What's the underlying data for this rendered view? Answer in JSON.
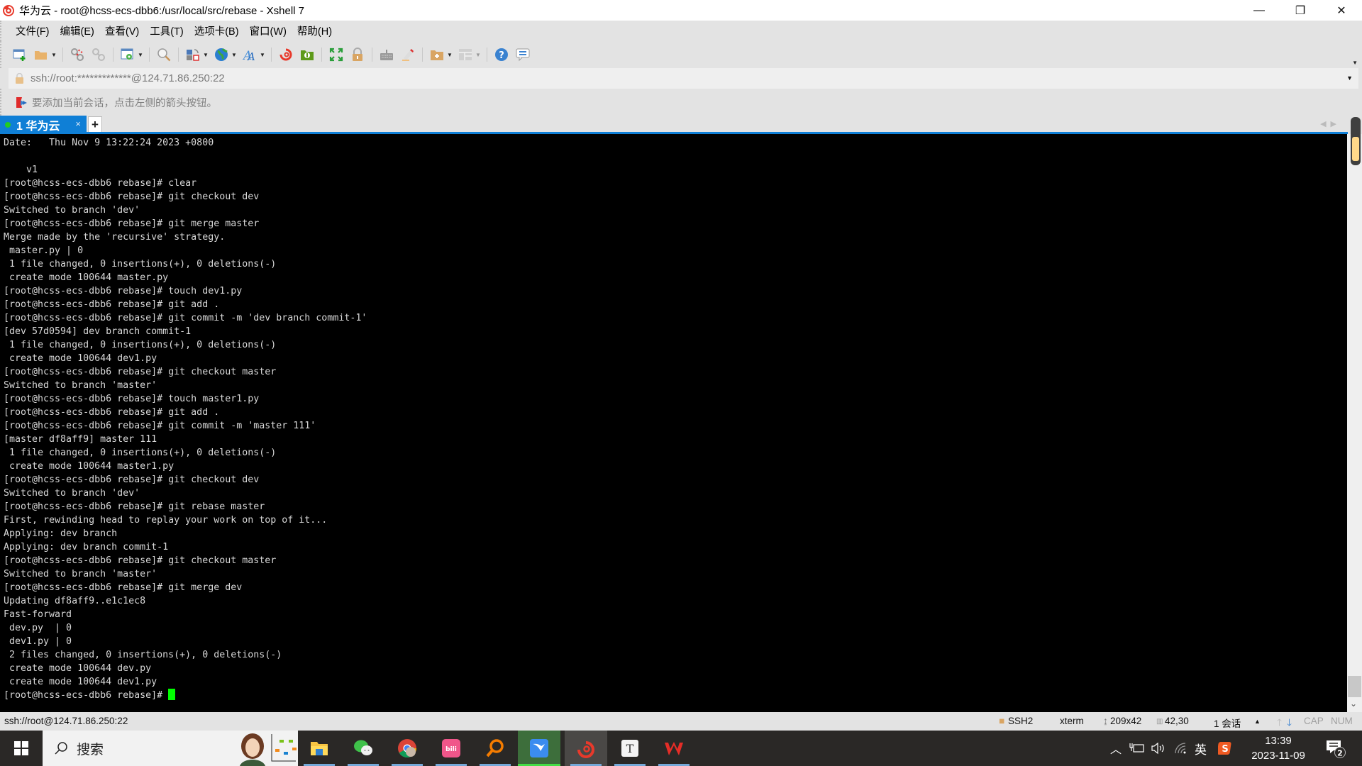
{
  "window": {
    "title": "华为云 - root@hcss-ecs-dbb6:/usr/local/src/rebase - Xshell 7",
    "controls": {
      "minimize": "—",
      "restore": "❐",
      "close": "✕"
    }
  },
  "menu": [
    "文件(F)",
    "编辑(E)",
    "查看(V)",
    "工具(T)",
    "选项卡(B)",
    "窗口(W)",
    "帮助(H)"
  ],
  "toolbar": {
    "buttons": [
      "new-session",
      "open",
      "disconnect",
      "reconnect",
      "properties",
      "find",
      "transfer",
      "globe",
      "font",
      "xftp",
      "xftp-green",
      "fullscreen",
      "lock",
      "keyboard",
      "highlight",
      "new-folder",
      "layout",
      "help",
      "chat"
    ]
  },
  "address": {
    "value": "ssh://root:*************@124.71.86.250:22"
  },
  "hint": {
    "text": "要添加当前会话，点击左侧的箭头按钮。"
  },
  "tabs": [
    {
      "label": "1 华为云",
      "active": true,
      "close": "×"
    }
  ],
  "tab_add": "+",
  "terminal": {
    "lines": [
      "Date:   Thu Nov 9 13:22:24 2023 +0800",
      "",
      "    v1",
      "[root@hcss-ecs-dbb6 rebase]# clear",
      "[root@hcss-ecs-dbb6 rebase]# git checkout dev",
      "Switched to branch 'dev'",
      "[root@hcss-ecs-dbb6 rebase]# git merge master",
      "Merge made by the 'recursive' strategy.",
      " master.py | 0",
      " 1 file changed, 0 insertions(+), 0 deletions(-)",
      " create mode 100644 master.py",
      "[root@hcss-ecs-dbb6 rebase]# touch dev1.py",
      "[root@hcss-ecs-dbb6 rebase]# git add .",
      "[root@hcss-ecs-dbb6 rebase]# git commit -m 'dev branch commit-1'",
      "[dev 57d0594] dev branch commit-1",
      " 1 file changed, 0 insertions(+), 0 deletions(-)",
      " create mode 100644 dev1.py",
      "[root@hcss-ecs-dbb6 rebase]# git checkout master",
      "Switched to branch 'master'",
      "[root@hcss-ecs-dbb6 rebase]# touch master1.py",
      "[root@hcss-ecs-dbb6 rebase]# git add .",
      "[root@hcss-ecs-dbb6 rebase]# git commit -m 'master 111'",
      "[master df8aff9] master 111",
      " 1 file changed, 0 insertions(+), 0 deletions(-)",
      " create mode 100644 master1.py",
      "[root@hcss-ecs-dbb6 rebase]# git checkout dev",
      "Switched to branch 'dev'",
      "[root@hcss-ecs-dbb6 rebase]# git rebase master",
      "First, rewinding head to replay your work on top of it...",
      "Applying: dev branch",
      "Applying: dev branch commit-1",
      "[root@hcss-ecs-dbb6 rebase]# git checkout master",
      "Switched to branch 'master'",
      "[root@hcss-ecs-dbb6 rebase]# git merge dev",
      "Updating df8aff9..e1c1ec8",
      "Fast-forward",
      " dev.py  | 0",
      " dev1.py | 0",
      " 2 files changed, 0 insertions(+), 0 deletions(-)",
      " create mode 100644 dev.py",
      " create mode 100644 dev1.py"
    ],
    "prompt": "[root@hcss-ecs-dbb6 rebase]# ",
    "cursor_color": "#00ff00"
  },
  "status": {
    "connection": "ssh://root@124.71.86.250:22",
    "protocol": "SSH2",
    "terminal_type": "xterm",
    "size": "209x42",
    "cursor_pos": "42,30",
    "sessions": "1 会话",
    "cap": "CAP",
    "num": "NUM"
  },
  "taskbar": {
    "search_label": "搜索",
    "apps": [
      "file-explorer",
      "wechat",
      "chrome",
      "bilibili",
      "search-app",
      "feishu-app",
      "xshell",
      "typora",
      "wps"
    ],
    "tray": {
      "ime": "英",
      "time": "13:39",
      "date": "2023-11-09",
      "notifications": "2"
    }
  },
  "colors": {
    "accent": "#0f7fd6",
    "terminal_bg": "#000000",
    "terminal_fg": "#d8d8d8"
  }
}
